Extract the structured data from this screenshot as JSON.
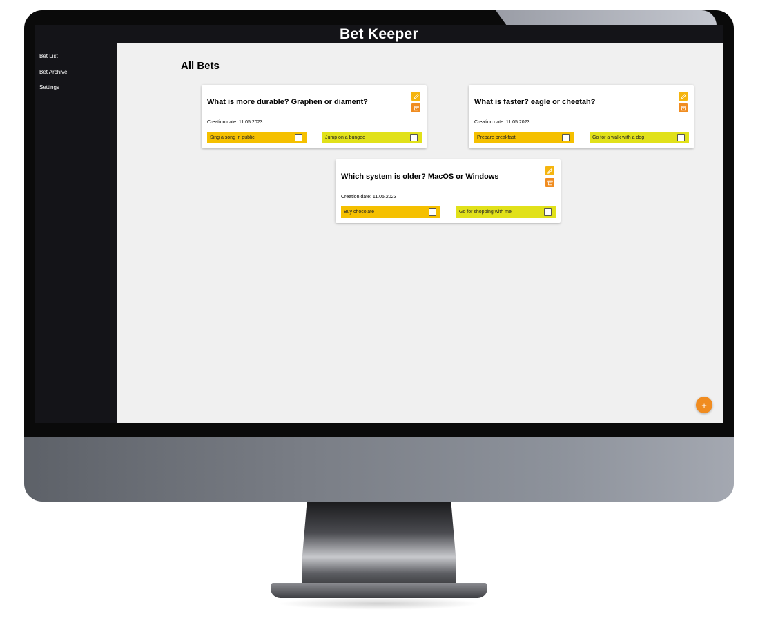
{
  "app": {
    "title": "Bet Keeper"
  },
  "sidebar": {
    "items": [
      {
        "label": "Bet List"
      },
      {
        "label": "Bet Archive"
      },
      {
        "label": "Settings"
      }
    ]
  },
  "main": {
    "title": "All Bets",
    "add_icon": "plus-icon",
    "add_glyph": "+",
    "bets": [
      {
        "question": "What is more durable? Graphen or diament?",
        "creation_date": "Creation date: 11.05.2023",
        "options": [
          {
            "label": "Sing a song in public",
            "checked": false
          },
          {
            "label": "Jump on a bungee",
            "checked": false
          }
        ]
      },
      {
        "question": "What is faster? eagle or cheetah?",
        "creation_date": "Creation date: 11.05.2023",
        "options": [
          {
            "label": "Prepare breakfast",
            "checked": false
          },
          {
            "label": "Go for a walk with a dog",
            "checked": false
          }
        ]
      },
      {
        "question": "Which system is older? MacOS or Windows",
        "creation_date": "Creation date: 11.05.2023",
        "options": [
          {
            "label": "Buy chocolate",
            "checked": false
          },
          {
            "label": "Go for shopping with me",
            "checked": false
          }
        ]
      }
    ]
  },
  "colors": {
    "sidebar_bg": "#141418",
    "content_bg": "#f0f0f0",
    "edit_button": "#f5b50f",
    "archive_button": "#f08c20",
    "option_left": "#f5c000",
    "option_right": "#e1e11a",
    "add_button": "#f08c20"
  },
  "icons": {
    "edit": "pencil-icon",
    "archive": "archive-box-icon",
    "add": "plus-icon"
  }
}
